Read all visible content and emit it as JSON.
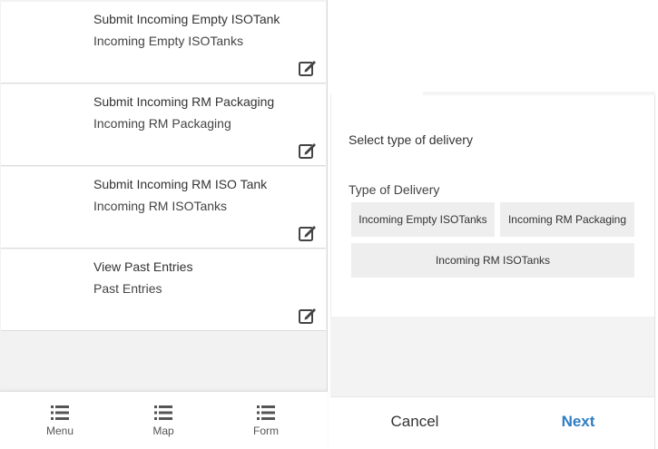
{
  "list": {
    "items": [
      {
        "title": "Submit Incoming Empty ISOTank",
        "subtitle": "Incoming Empty ISOTanks",
        "icon": "edit-icon"
      },
      {
        "title": "Submit Incoming RM Packaging",
        "subtitle": "Incoming RM Packaging",
        "icon": "edit-icon"
      },
      {
        "title": "Submit Incoming RM ISO Tank",
        "subtitle": "Incoming RM ISOTanks",
        "icon": "edit-icon"
      },
      {
        "title": "View Past Entries",
        "subtitle": "Past Entries",
        "icon": "edit-icon"
      }
    ]
  },
  "bottom_nav": {
    "items": [
      {
        "label": "Menu",
        "icon": "list-icon"
      },
      {
        "label": "Map",
        "icon": "list-icon"
      },
      {
        "label": "Form",
        "icon": "list-icon"
      }
    ]
  },
  "dialog": {
    "prompt": "Select type of delivery",
    "field_label": "Type of Delivery",
    "options": [
      "Incoming Empty ISOTanks",
      "Incoming RM Packaging",
      "Incoming RM ISOTanks"
    ],
    "cancel_label": "Cancel",
    "next_label": "Next"
  },
  "colors": {
    "accent": "#2f7cc4",
    "option_bg": "#eeeeee",
    "panel_bg": "#f2f2f2"
  }
}
